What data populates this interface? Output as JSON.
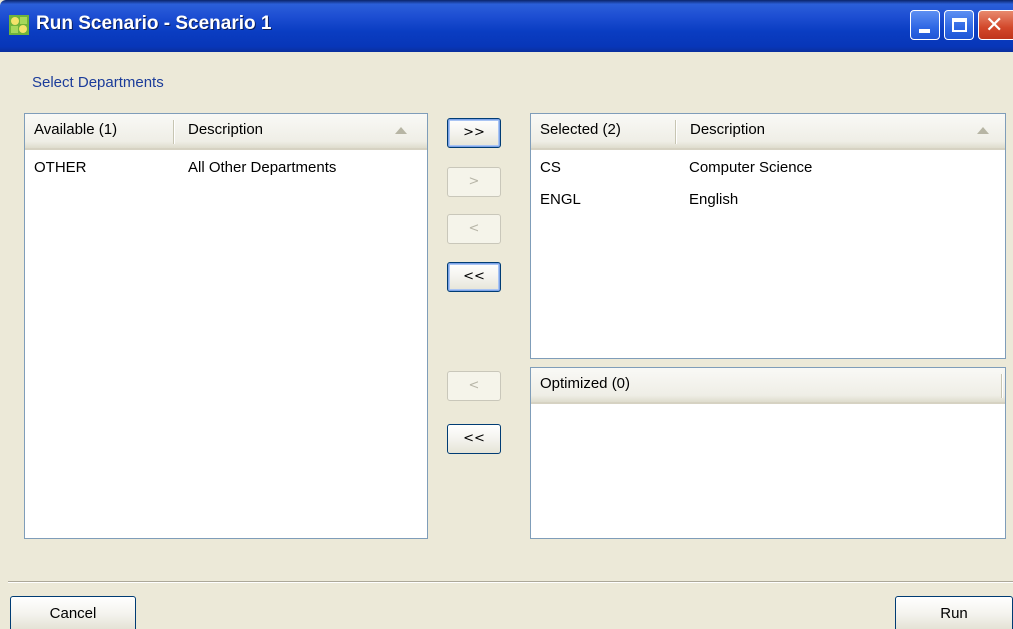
{
  "window": {
    "title": "Run Scenario - Scenario 1",
    "colors": {
      "titlebar": "#0a3dc2",
      "close": "#d2472a",
      "accent_text": "#1b3c9a",
      "face": "#ece9d8"
    }
  },
  "section_label": "Select Departments",
  "available": {
    "columns": [
      "Available (1)",
      "Description"
    ],
    "rows": [
      {
        "code": "OTHER",
        "description": "All Other Departments"
      }
    ]
  },
  "selected": {
    "columns": [
      "Selected (2)",
      "Description"
    ],
    "rows": [
      {
        "code": "CS",
        "description": "Computer Science"
      },
      {
        "code": "ENGL",
        "description": "English"
      }
    ]
  },
  "optimized": {
    "columns": [
      "Optimized (0)"
    ]
  },
  "transfer_buttons": {
    "add_all": ">>",
    "add": ">",
    "remove": "<",
    "remove_all": "<<",
    "opt_remove": "<",
    "opt_remove_all": "<<"
  },
  "footer": {
    "cancel": "Cancel",
    "run": "Run"
  },
  "icons": [
    "app-icon",
    "minimize-icon",
    "maximize-icon",
    "close-icon",
    "sort-ascending-icon"
  ]
}
